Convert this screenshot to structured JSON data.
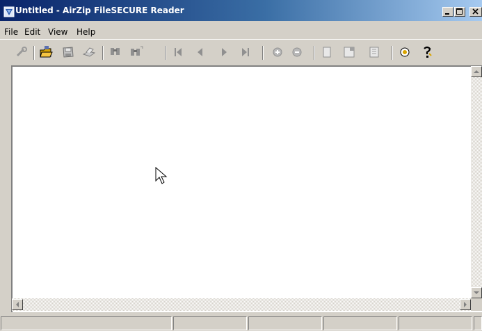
{
  "window": {
    "title": "Untitled - AirZip FileSECURE Reader",
    "icon": "app-icon",
    "controls": [
      "minimize-icon",
      "maximize-icon",
      "close-icon"
    ]
  },
  "menu": {
    "items": [
      "File",
      "Edit",
      "View",
      "Help"
    ]
  },
  "toolbar": {
    "buttons": [
      "unlock-icon",
      "open-folder-icon",
      "save-icon",
      "print-icon",
      "find-icon",
      "find-next-icon",
      "first-page-icon",
      "previous-page-icon",
      "next-page-icon",
      "last-page-icon",
      "zoom-in-icon",
      "zoom-out-icon",
      "actual-size-icon",
      "fit-width-icon",
      "fit-page-icon",
      "about-icon",
      "help-icon"
    ]
  },
  "document": {
    "content": ""
  },
  "statusbar": {
    "panes": [
      "",
      "",
      "",
      "",
      "",
      ""
    ]
  },
  "colors": {
    "titlebar_start": "#0a246a",
    "titlebar_end": "#a6caf0",
    "chrome": "#d4d0c8",
    "client": "#ffffff"
  }
}
